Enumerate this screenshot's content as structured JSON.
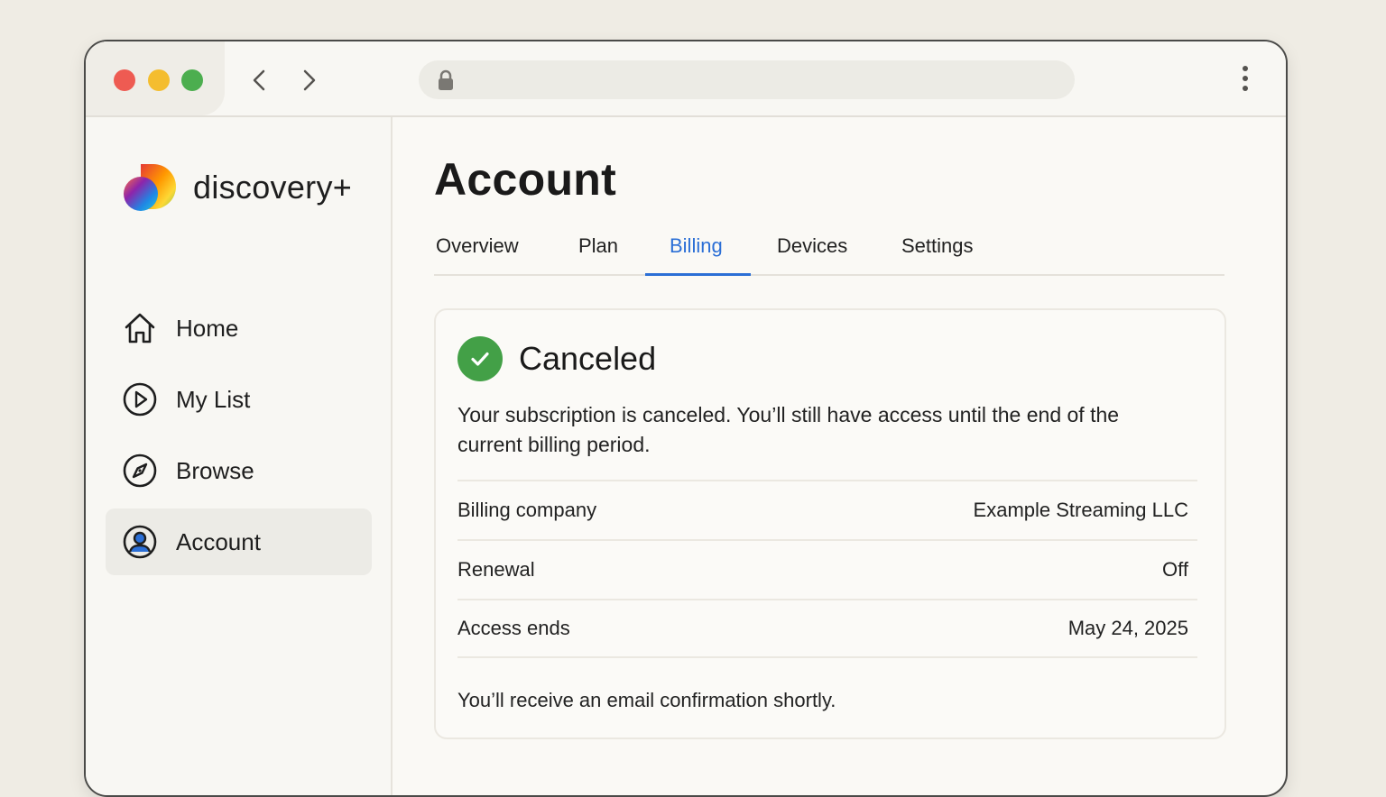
{
  "browser": {
    "icons": {
      "back": "chevron-left-icon",
      "forward": "chevron-right-icon",
      "lock": "lock-icon",
      "menu": "kebab-menu-icon"
    },
    "url": ""
  },
  "brand": {
    "name": "discovery+",
    "logo_colors": [
      "#e53935",
      "#ff9800",
      "#fdd835",
      "#43a047",
      "#1e88e5",
      "#8e24aa"
    ]
  },
  "sidebar": {
    "items": [
      {
        "label": "Home",
        "icon": "home-icon",
        "active": false
      },
      {
        "label": "My List",
        "icon": "play-circle-icon",
        "active": false
      },
      {
        "label": "Browse",
        "icon": "compass-icon",
        "active": false
      },
      {
        "label": "Account",
        "icon": "user-circle-icon",
        "active": true
      }
    ]
  },
  "page": {
    "title": "Account",
    "tabs": [
      {
        "label": "Overview",
        "active": false
      },
      {
        "label": "Plan",
        "active": false
      },
      {
        "label": "Billing",
        "active": true
      },
      {
        "label": "Devices",
        "active": false
      },
      {
        "label": "Settings",
        "active": false
      }
    ]
  },
  "billing": {
    "status": "Canceled",
    "status_icon": "check-circle-icon",
    "message": "Your subscription is canceled. You’ll still have access until the end of the current billing period.",
    "details": [
      {
        "label": "Billing company",
        "value": "Example Streaming LLC"
      },
      {
        "label": "Renewal",
        "value": "Off"
      },
      {
        "label": "Access ends",
        "value": "May 24, 2025"
      }
    ],
    "footnote": "You’ll receive an email confirmation shortly."
  },
  "colors": {
    "accent": "#2b6fd6",
    "success": "#43a047",
    "background": "#efece4",
    "window": "#faf9f5"
  }
}
